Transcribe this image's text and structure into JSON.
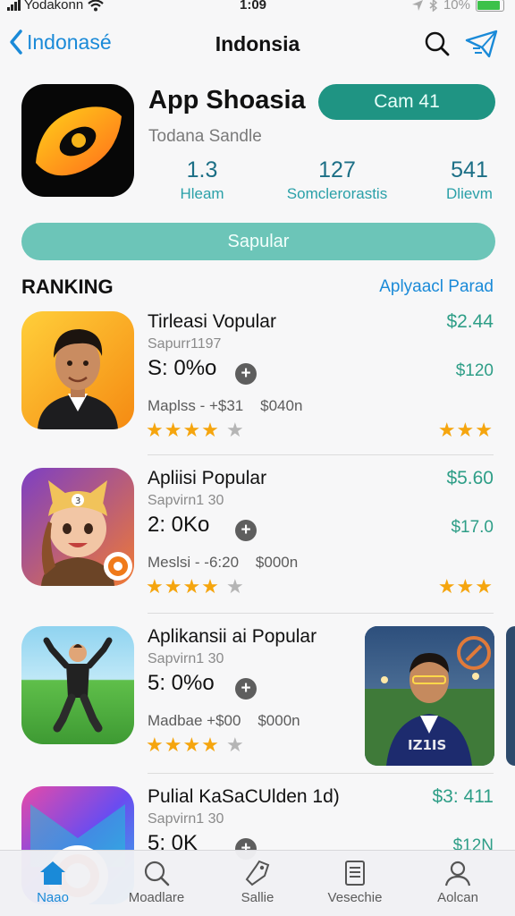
{
  "status": {
    "carrier": "Yodakonn",
    "time": "1:09",
    "battery": "10%"
  },
  "nav": {
    "back_label": "Indonasé",
    "title": "Indonsia"
  },
  "app": {
    "name": "App Shoasia",
    "get_label": "Cam 41",
    "subtitle": "Todana Sandle",
    "stats": [
      {
        "value": "1.3",
        "label": "Hleam"
      },
      {
        "value": "127",
        "label": "Somclerorastis"
      },
      {
        "value": "541",
        "label": "Dlievm"
      }
    ],
    "wide_button": "Sapular"
  },
  "section": {
    "title": "RANKING",
    "link": "Aplyaacl Parad"
  },
  "rows": [
    {
      "title": "Tirleasi Vopular",
      "subtitle": "Sapurr1197",
      "pct": "S: 0%o",
      "meta": "Maplss - +$31    $040n",
      "price": "$2.44",
      "price2": "$120",
      "stars": 4,
      "stars_right": 3
    },
    {
      "title": "Apliisi Popular",
      "subtitle": "Sapvirn1 30",
      "pct": "2: 0Ko",
      "meta": "Meslsi - -6:20    $000n",
      "price": "$5.60",
      "price2": "$17.0",
      "stars": 4,
      "stars_right": 3
    },
    {
      "title": "Aplikansii ai Popular",
      "subtitle": "Sapvirn1 30",
      "pct": "5: 0%o",
      "meta": "Madbae +$00    $000n",
      "stars": 4
    },
    {
      "title": "Pulial KaSaCUlden 1d)",
      "subtitle": "Sapvirn1 30",
      "pct": "5: 0K",
      "price": "$3: 411",
      "price2": "$12N"
    }
  ],
  "promo": {
    "jersey_text": "IZ1IS"
  },
  "tabs": [
    {
      "label": "Naao",
      "icon": "home-icon"
    },
    {
      "label": "Moadlare",
      "icon": "search-icon"
    },
    {
      "label": "Sallie",
      "icon": "tag-icon"
    },
    {
      "label": "Vesechie",
      "icon": "document-icon"
    },
    {
      "label": "Aolcan",
      "icon": "person-icon"
    }
  ],
  "colors": {
    "accent": "#1a8ad8",
    "get_button": "#1f9483",
    "wide_button": "#6cc5b8",
    "price": "#2e9e87",
    "star": "#f5a50e"
  }
}
